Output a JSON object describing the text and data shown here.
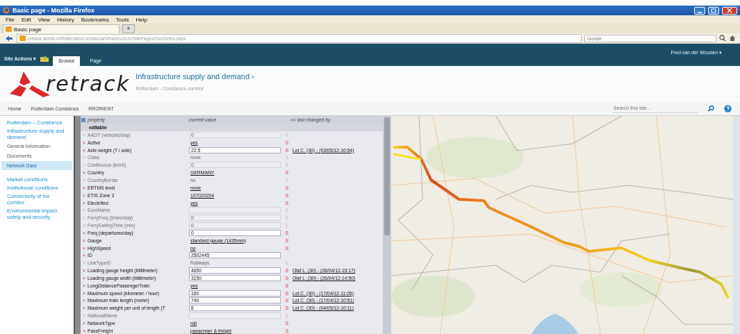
{
  "browser": {
    "title": "Basic page - Mozilla Firefox",
    "menu": [
      "File",
      "Edit",
      "View",
      "History",
      "Bookmarks",
      "Tools",
      "Help"
    ],
    "tabs": [
      {
        "label": "Basic page",
        "selected": true
      }
    ],
    "new_tab": "+",
    "url": "retrack.demis.nl/RotterdamConstanza/Infrastructure/SitePages/GeoDemo.aspx",
    "search": {
      "placeholder": "Google"
    }
  },
  "ribbon": {
    "site_actions": "Site Actions ▾",
    "tabs": [
      {
        "label": "Browse",
        "selected": true
      },
      {
        "label": "Page",
        "selected": false
      }
    ],
    "user": "Fred van der Wouden ▾"
  },
  "header": {
    "logo": "retrack",
    "title": "Infrastructure supply and demand ›",
    "subtitle": "Rotterdam - Constanza corridor"
  },
  "breadcrumb": [
    "Home",
    "Rotterdam-Constanza",
    "RRORIENT"
  ],
  "site_search": {
    "placeholder": "Search this site..."
  },
  "sidebar": {
    "items": [
      {
        "label": "Rotterdam – Constanza",
        "kind": "link",
        "selected": false
      },
      {
        "label": "Infrastructure supply and demand",
        "kind": "link",
        "selected": false
      },
      {
        "label": "General Information",
        "kind": "page",
        "selected": false
      },
      {
        "label": "Documents",
        "kind": "page",
        "selected": false
      },
      {
        "label": "Network Data",
        "kind": "page",
        "selected": true
      },
      {
        "label": "Market conditions",
        "kind": "link",
        "selected": false
      },
      {
        "label": "Institutional conditions",
        "kind": "link",
        "selected": false
      },
      {
        "label": "Connectivity of the corridor",
        "kind": "link",
        "selected": false
      },
      {
        "label": "Environmental impact, safety and security",
        "kind": "link",
        "selected": false
      }
    ]
  },
  "grid": {
    "columns": [
      "property",
      "current value",
      "<< last changed by"
    ],
    "group": "editable",
    "rows": [
      {
        "remove": "×",
        "property": "AADT (vehicles/day)",
        "value": "0",
        "kind": "input",
        "disabled": true,
        "flag": "S"
      },
      {
        "remove": "×",
        "property": "Active",
        "value": "yes",
        "kind": "link",
        "disabled": false,
        "flag": "S"
      },
      {
        "remove": "×",
        "property": "Axle weight (T / axle)",
        "value": "22.5",
        "kind": "input",
        "disabled": false,
        "flag": "S",
        "changed_by": "Lot C. (30) - (03/05/12-10:54)"
      },
      {
        "remove": "×",
        "property": "Class",
        "value": "none",
        "kind": "text",
        "disabled": true,
        "flag": "S"
      },
      {
        "remove": "×",
        "property": "Continuous (km/h)",
        "value": "0",
        "kind": "input",
        "disabled": true,
        "flag": "S"
      },
      {
        "remove": "×",
        "property": "Country",
        "value": "GERMANY",
        "kind": "link",
        "disabled": false,
        "flag": "S"
      },
      {
        "remove": "×",
        "property": "CountryBorder",
        "value": "no",
        "kind": "text",
        "disabled": true,
        "flag": "S"
      },
      {
        "remove": "×",
        "property": "ERTMS level",
        "value": "none",
        "kind": "link",
        "disabled": false,
        "flag": "S"
      },
      {
        "remove": "×",
        "property": "ETIS Zone 3",
        "value": "107020204",
        "kind": "link",
        "disabled": false,
        "flag": "S"
      },
      {
        "remove": "×",
        "property": "Electrified",
        "value": "yes",
        "kind": "link",
        "disabled": false,
        "flag": "S"
      },
      {
        "remove": "×",
        "property": "EuroName",
        "kind": "input",
        "disabled": true,
        "flag": "S"
      },
      {
        "remove": "×",
        "property": "FerryFreq (times/day)",
        "value": "0",
        "kind": "input",
        "disabled": true,
        "flag": "S"
      },
      {
        "remove": "×",
        "property": "FerrySailingTime (min)",
        "value": "0",
        "kind": "input",
        "disabled": true,
        "flag": "S"
      },
      {
        "remove": "×",
        "property": "Freq (departures/day)",
        "value": "0",
        "kind": "input",
        "disabled": false,
        "flag": "S"
      },
      {
        "remove": "×",
        "property": "Gauge",
        "value": "standard gauge (1435mm)",
        "kind": "link",
        "disabled": false,
        "flag": "S"
      },
      {
        "remove": "×",
        "property": "HighSpeed",
        "value": "no",
        "kind": "link",
        "disabled": false,
        "flag": "S"
      },
      {
        "remove": "×",
        "property": "ID",
        "value": "2502445",
        "kind": "input",
        "disabled": false
      },
      {
        "remove": "×",
        "property": "LinkTypeID",
        "value": "Railways",
        "kind": "text",
        "disabled": true,
        "flag": "S"
      },
      {
        "remove": "×",
        "property": "Loading gauge height (Millimeter)",
        "value": "4650",
        "kind": "input",
        "disabled": false,
        "flag": "S",
        "changed_by": "Olaf L. (30) - (26/04/12-15:17)"
      },
      {
        "remove": "×",
        "property": "Loading gauge width (Millimeter)",
        "value": "3150",
        "kind": "input",
        "disabled": false,
        "flag": "S",
        "changed_by": "Olaf L. (30) - (26/04/12-14:50)"
      },
      {
        "remove": "×",
        "property": "LongDistancePassengerTrain",
        "value": "yes",
        "kind": "link",
        "disabled": false,
        "flag": "S"
      },
      {
        "remove": "×",
        "property": "Maximum speed (kilometer / hour)",
        "value": "160",
        "kind": "input",
        "disabled": false,
        "flag": "S",
        "changed_by": "Lot C. (30) - (17/04/12-11:05)"
      },
      {
        "remove": "×",
        "property": "Maximum train length (meter)",
        "value": "740",
        "kind": "input",
        "disabled": false,
        "flag": "S",
        "changed_by": "Lot C. (30) - (17/04/12-10:51)"
      },
      {
        "remove": "×",
        "property": "Maximum weight per unit of length (T",
        "value": "8",
        "kind": "input",
        "disabled": false,
        "flag": "S",
        "changed_by": "Lot C. (30) - (04/05/12-10:11)"
      },
      {
        "remove": "×",
        "property": "NationalName",
        "kind": "input",
        "disabled": true,
        "flag": "S"
      },
      {
        "remove": "×",
        "property": "NetworkType",
        "value": "rail",
        "kind": "link",
        "disabled": false,
        "flag": "S"
      },
      {
        "remove": "×",
        "property": "PassFreight",
        "value": "passenger & freight",
        "kind": "link",
        "disabled": false,
        "flag": "S"
      }
    ]
  }
}
